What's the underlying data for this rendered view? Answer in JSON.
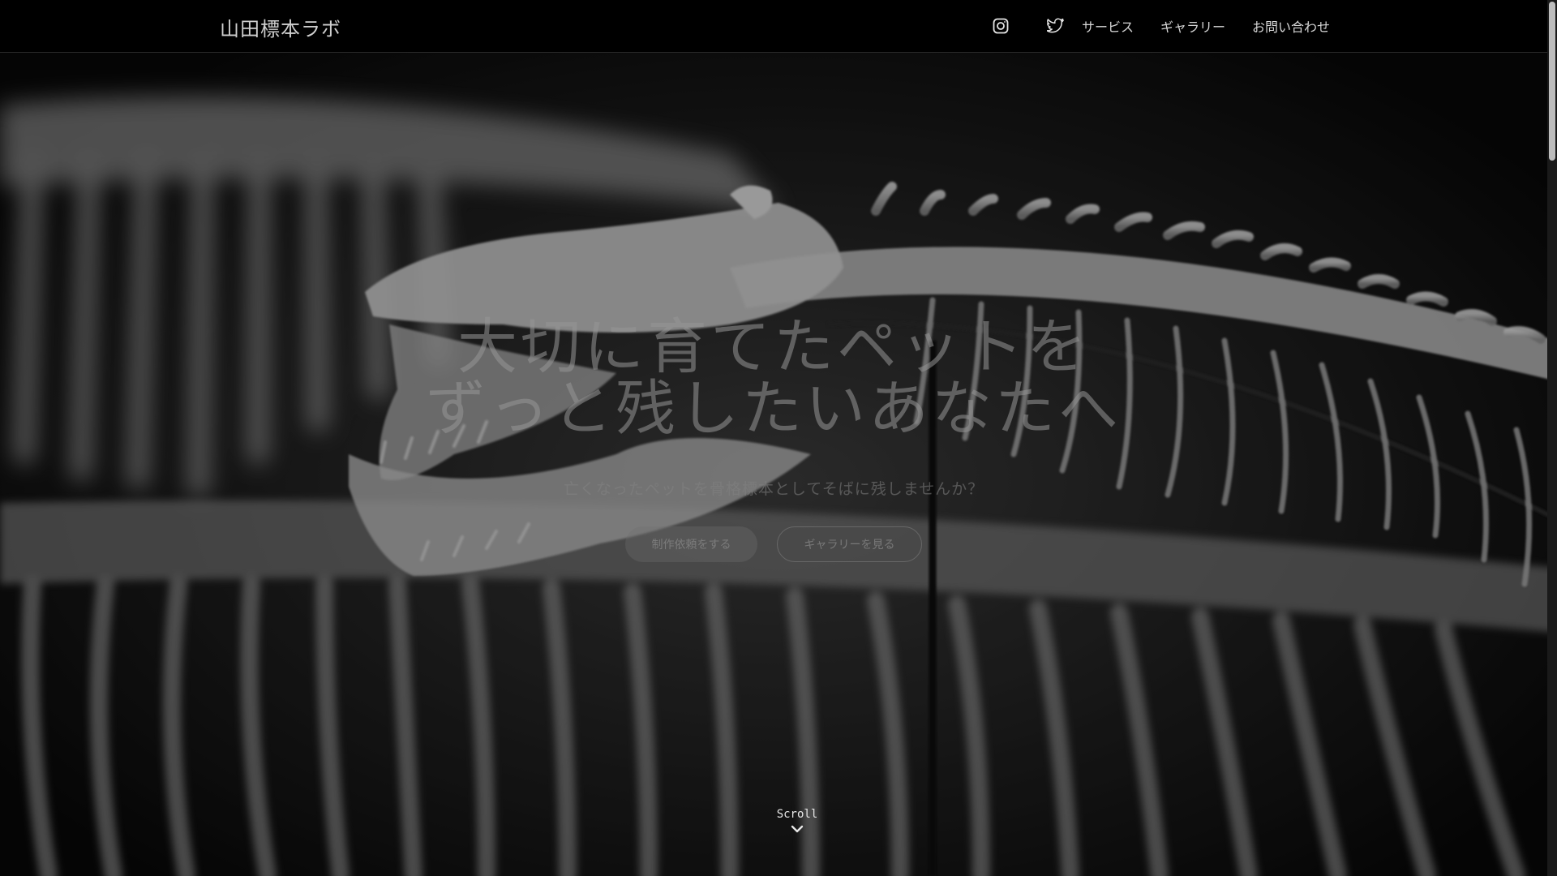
{
  "header": {
    "logo": "山田標本ラボ",
    "icons": [
      "instagram-icon",
      "twitter-icon"
    ],
    "nav": [
      "サービス",
      "ギャラリー",
      "お問い合わせ"
    ]
  },
  "hero": {
    "headline_line1": "大切に育てたペットを",
    "headline_line2": "ずっと残したいあなたへ",
    "subtitle": "亡くなったペットを骨格標本としてそばに残しませんか？",
    "primary_button": "制作依頼をする",
    "secondary_button": "ギャラリーを見る",
    "scroll_label": "Scroll"
  },
  "colors": {
    "header_bg": "#000000",
    "nav_text": "#d6d6d6",
    "logo_text": "#cfcfcf"
  }
}
